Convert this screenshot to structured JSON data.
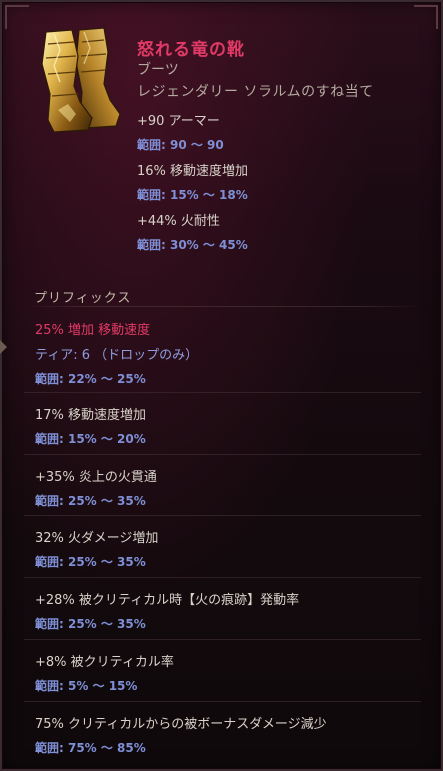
{
  "item": {
    "name": "怒れる竜の靴",
    "type": "ブーツ",
    "rarity": "レジェンダリー ソラルムのすね当て",
    "icon": "golden-boots-icon"
  },
  "base_stats": [
    {
      "text": "+90 アーマー",
      "range": "範囲: 90 〜 90"
    },
    {
      "text": "16% 移動速度増加",
      "range": "範囲: 15% 〜 18%"
    },
    {
      "text": "+44% 火耐性",
      "range": "範囲: 30% 〜 45%"
    }
  ],
  "prefix": {
    "title": "プリフィックス",
    "special": {
      "text": "25% 増加 移動速度",
      "tier": "ティア: 6 （ドロップのみ）",
      "range": "範囲: 22% 〜 25%"
    },
    "affixes": [
      {
        "text": "17% 移動速度増加",
        "range": "範囲: 15% 〜 20%"
      },
      {
        "text": "+35% 炎上の火貫通",
        "range": "範囲: 25% 〜 35%"
      },
      {
        "text": "32% 火ダメージ増加",
        "range": "範囲: 25% 〜 35%"
      },
      {
        "text": "+28% 被クリティカル時【火の痕跡】発動率",
        "range": "範囲: 25% 〜 35%"
      },
      {
        "text": "+8% 被クリティカル率",
        "range": "範囲: 5% 〜 15%"
      },
      {
        "text": "75% クリティカルからの被ボーナスダメージ減少",
        "range": "範囲: 75% 〜 85%"
      }
    ]
  },
  "colors": {
    "legendary_name": "#e23a67",
    "range_text": "#7f8fd6",
    "normal_text": "#d8d2ca"
  }
}
